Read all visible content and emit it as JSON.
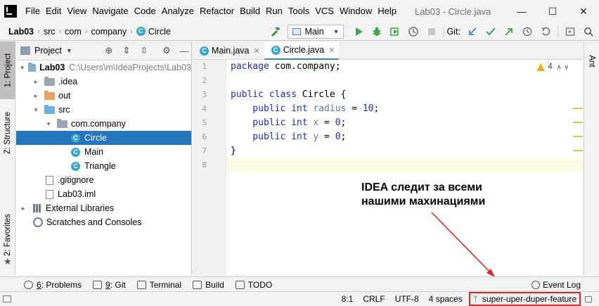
{
  "menubar": {
    "items": [
      {
        "label": "File",
        "id": "file"
      },
      {
        "label": "Edit",
        "id": "edit"
      },
      {
        "label": "View",
        "id": "view"
      },
      {
        "label": "Navigate",
        "id": "navigate"
      },
      {
        "label": "Code",
        "id": "code"
      },
      {
        "label": "Analyze",
        "id": "analyze"
      },
      {
        "label": "Refactor",
        "id": "refactor"
      },
      {
        "label": "Build",
        "id": "build"
      },
      {
        "label": "Run",
        "id": "run"
      },
      {
        "label": "Tools",
        "id": "tools"
      },
      {
        "label": "VCS",
        "id": "vcs"
      },
      {
        "label": "Window",
        "id": "window"
      },
      {
        "label": "Help",
        "id": "help"
      }
    ],
    "window_title": "Lab03 - Circle.java",
    "controls": {
      "minimize": "—",
      "maximize": "☐",
      "close": "✕"
    }
  },
  "toolbar": {
    "breadcrumb": [
      "Lab03",
      "src",
      "com",
      "company",
      "Circle"
    ],
    "run_config": "Main",
    "git_label": "Git:"
  },
  "left_stripe": {
    "project": "1: Project",
    "structure": "Z: Structure",
    "favorites": "2: Favorites"
  },
  "right_stripe": {
    "ant": "Ant"
  },
  "project_panel": {
    "title": "Project",
    "tree": [
      {
        "label": "Lab03",
        "extra": "C:\\Users\\m\\IdeaProjects\\Lab03",
        "level": 0,
        "twisty": "▾",
        "icon": "folder-blue"
      },
      {
        "label": ".idea",
        "level": 1,
        "twisty": "▸",
        "icon": "folder-grey"
      },
      {
        "label": "out",
        "level": 1,
        "twisty": "▸",
        "icon": "folder-orange"
      },
      {
        "label": "src",
        "level": 1,
        "twisty": "▾",
        "icon": "folder-lightblue"
      },
      {
        "label": "com.company",
        "level": 2,
        "twisty": "▾",
        "icon": "folder-grey"
      },
      {
        "label": "Circle",
        "level": 3,
        "twisty": "",
        "icon": "class",
        "selected": true
      },
      {
        "label": "Main",
        "level": 3,
        "twisty": "",
        "icon": "class"
      },
      {
        "label": "Triangle",
        "level": 3,
        "twisty": "",
        "icon": "class"
      },
      {
        "label": ".gitignore",
        "level": 1,
        "twisty": "",
        "icon": "file"
      },
      {
        "label": "Lab03.iml",
        "level": 1,
        "twisty": "",
        "icon": "file"
      },
      {
        "label": "External Libraries",
        "level": 0,
        "twisty": "▸",
        "icon": "library"
      },
      {
        "label": "Scratches and Consoles",
        "level": 0,
        "twisty": "",
        "icon": "scratch"
      }
    ]
  },
  "editor": {
    "tabs": [
      {
        "label": "Main.java",
        "active": false
      },
      {
        "label": "Circle.java",
        "active": true
      }
    ],
    "warnings": "4",
    "line_numbers": [
      "1",
      "2",
      "3",
      "4",
      "5",
      "6",
      "7",
      "8"
    ],
    "code": {
      "l1a": "package",
      "l1b": " com.company;",
      "l3a": "public class",
      "l3b": " Circle {",
      "l4a": "    public int",
      "l4b": " radius",
      "l4c": " = ",
      "l4d": "10",
      "l4e": ";",
      "l5a": "    public int",
      "l5b": " x",
      "l5c": " = ",
      "l5d": "0",
      "l5e": ";",
      "l6a": "    public int",
      "l6b": " y",
      "l6c": " = ",
      "l6d": "0",
      "l6e": ";",
      "l7": "}"
    }
  },
  "annotation": {
    "line1": "IDEA следит за всеми",
    "line2": "нашими махинациями",
    "color": "#e0242b"
  },
  "tool_tabs": [
    {
      "num": "6",
      "label": ": Problems"
    },
    {
      "num": "9",
      "label": ": Git"
    },
    {
      "num": "",
      "label": "Terminal"
    },
    {
      "num": "",
      "label": "Build"
    },
    {
      "num": "",
      "label": "TODO"
    }
  ],
  "event_log": "Event Log",
  "statusbar": {
    "position": "8:1",
    "line_sep": "CRLF",
    "encoding": "UTF-8",
    "indent": "4 spaces",
    "branch": "super-uper-duper-feature"
  }
}
